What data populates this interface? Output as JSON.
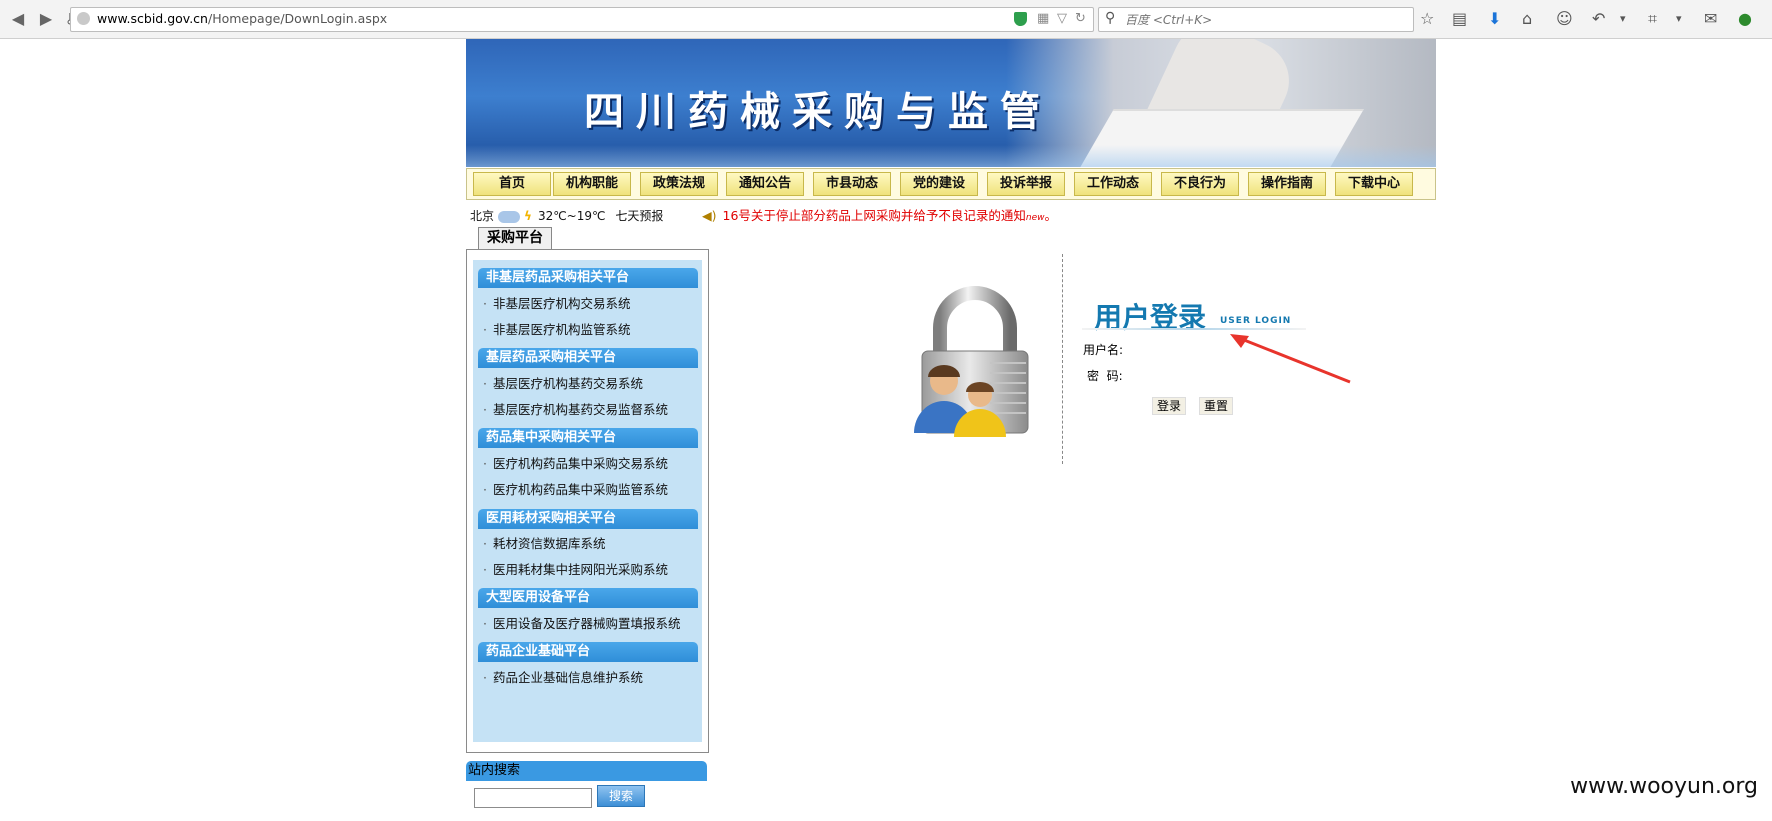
{
  "browser": {
    "url_host": "www.scbid.gov.cn",
    "url_path": "/Homepage/DownLogin.aspx",
    "search_placeholder": "百度 <Ctrl+K>"
  },
  "banner": {
    "title": "四川药械采购与监管"
  },
  "nav": {
    "items": [
      "首页",
      "机构职能",
      "政策法规",
      "通知公告",
      "市县动态",
      "党的建设",
      "投诉举报",
      "工作动态",
      "不良行为",
      "操作指南",
      "下载中心"
    ]
  },
  "weather": {
    "city": "北京",
    "temp": "32℃~19℃",
    "forecast_link": "七天预报"
  },
  "notice": {
    "text": "16号关于停止部分药品上网采购并给予不良记录的通知",
    "badge": "new",
    "suffix": "。"
  },
  "sidebar": {
    "tab": "采购平台",
    "sections": [
      {
        "title": "非基层药品采购相关平台",
        "items": [
          "非基层医疗机构交易系统",
          "非基层医疗机构监管系统"
        ]
      },
      {
        "title": "基层药品采购相关平台",
        "items": [
          "基层医疗机构基药交易系统",
          "基层医疗机构基药交易监督系统"
        ]
      },
      {
        "title": "药品集中采购相关平台",
        "items": [
          "医疗机构药品集中采购交易系统",
          "医疗机构药品集中采购监管系统"
        ]
      },
      {
        "title": "医用耗材采购相关平台",
        "items": [
          "耗材资信数据库系统",
          "医用耗材集中挂网阳光采购系统"
        ]
      },
      {
        "title": "大型医用设备平台",
        "items": [
          "医用设备及医疗器械购置填报系统"
        ]
      },
      {
        "title": "药品企业基础平台",
        "items": [
          "药品企业基础信息维护系统"
        ]
      }
    ]
  },
  "site_search": {
    "title": "站内搜索",
    "button": "搜索"
  },
  "login": {
    "title": "用户登录",
    "subtitle": "USER LOGIN",
    "username_label": "用户名:",
    "password_label": "密  码:",
    "login_button": "登录",
    "reset_button": "重置"
  },
  "watermark": "www.wooyun.org"
}
